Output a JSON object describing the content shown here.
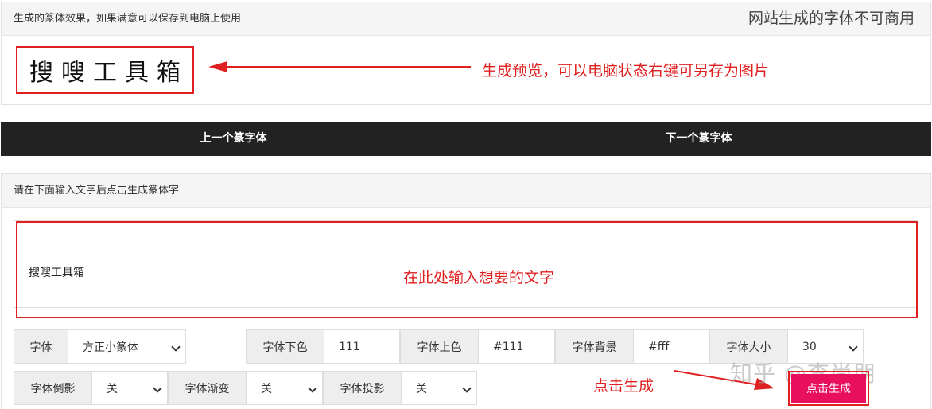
{
  "preview": {
    "header": "生成的篆体效果，如果满意可以保存到电脑上使用",
    "notice": "网站生成的字体不可商用",
    "chars": [
      "搜",
      "嗖",
      "工",
      "具",
      "箱"
    ]
  },
  "annotations": {
    "preview_note": "生成预览，可以电脑状态右键可另存为图片",
    "input_note": "在此处输入想要的文字",
    "generate_note": "点击生成"
  },
  "nav": {
    "prev": "上一个篆字体",
    "next": "下一个篆字体"
  },
  "input_panel": {
    "header": "请在下面输入文字后点击生成篆体字",
    "text_value": "搜嗖工具箱"
  },
  "controls": {
    "font": {
      "label": "字体",
      "value": "方正小篆体"
    },
    "bottom_color": {
      "label": "字体下色",
      "value": "111"
    },
    "top_color": {
      "label": "字体上色",
      "value": "#111"
    },
    "background": {
      "label": "字体背景",
      "value": "#fff"
    },
    "size": {
      "label": "字体大小",
      "value": "30"
    },
    "reflection": {
      "label": "字体倒影",
      "value": "关"
    },
    "gradient": {
      "label": "字体渐变",
      "value": "关"
    },
    "shadow": {
      "label": "字体投影",
      "value": "关"
    },
    "generate": "点击生成"
  },
  "watermark": "知乎 @李尚朋",
  "colors": {
    "annotation_red": "#e02020",
    "button_pink": "#e8105c",
    "nav_bg": "#222222"
  }
}
